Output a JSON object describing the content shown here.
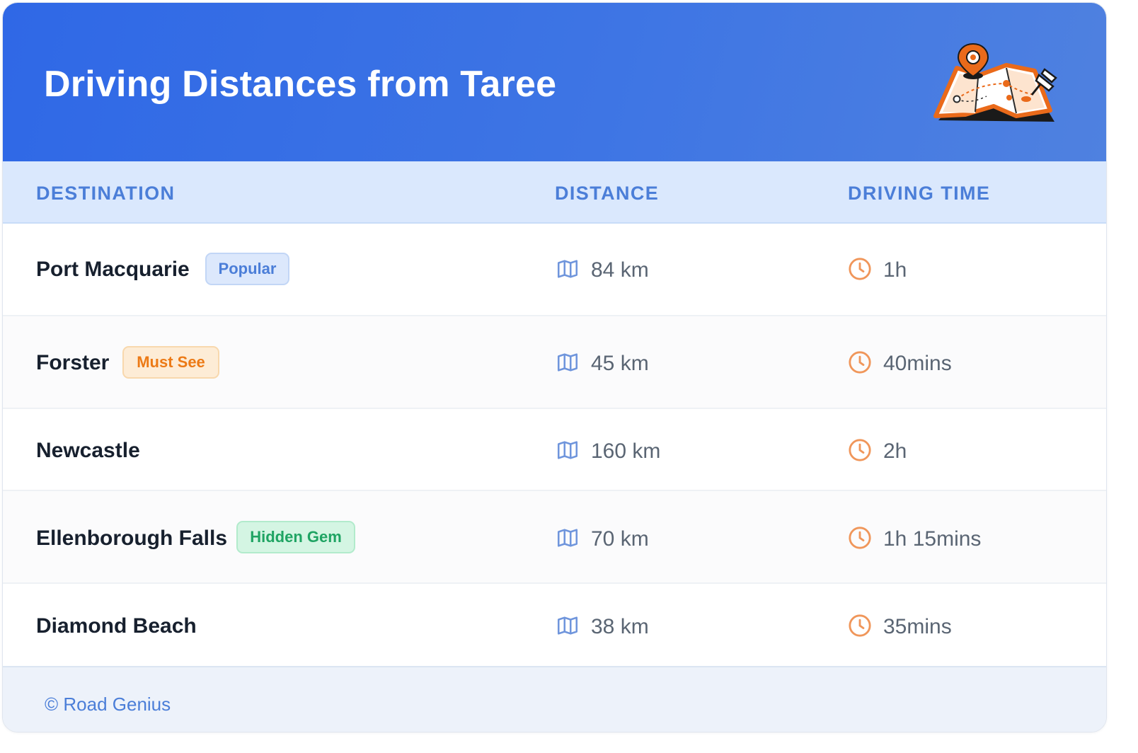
{
  "header": {
    "title": "Driving Distances from Taree",
    "illustration_icon": "folded-map-with-location-pin-icon",
    "gradient": [
      "#2f68e6",
      "#4f81e0"
    ]
  },
  "columns": {
    "destination": "DESTINATION",
    "distance": "DISTANCE",
    "driving_time": "DRIVING TIME"
  },
  "icons": {
    "distance": "map-icon",
    "time": "clock-icon"
  },
  "rows": [
    {
      "destination": "Port Macquarie",
      "badge": "Popular",
      "badge_type": "popular",
      "distance": "84 km",
      "time": "1h"
    },
    {
      "destination": "Forster",
      "badge": "Must See",
      "badge_type": "mustsee",
      "distance": "45 km",
      "time": "40mins"
    },
    {
      "destination": "Newcastle",
      "badge": "",
      "badge_type": "",
      "distance": "160 km",
      "time": "2h"
    },
    {
      "destination": "Ellenborough Falls",
      "badge": "Hidden Gem",
      "badge_type": "hidden",
      "distance": "70 km",
      "time": "1h 15mins"
    },
    {
      "destination": "Diamond Beach",
      "badge": "",
      "badge_type": "",
      "distance": "38 km",
      "time": "35mins"
    }
  ],
  "footer": {
    "credit": "© Road Genius"
  },
  "colors": {
    "accent_blue": "#4b7ed8",
    "accent_orange": "#ec7a16",
    "accent_green": "#1fa463"
  }
}
